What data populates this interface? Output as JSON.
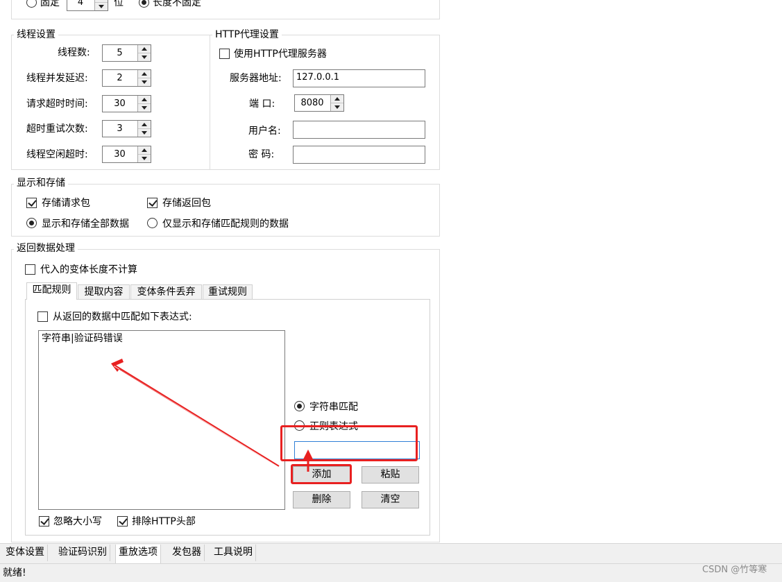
{
  "top_row": {
    "fixed_label": "固定",
    "digits_value": "4",
    "digits_unit": "位",
    "variable_label": "长度不固定"
  },
  "thread_settings": {
    "title": "线程设置",
    "fields": [
      {
        "label": "线程数:",
        "value": "5"
      },
      {
        "label": "线程并发延迟:",
        "value": "2"
      },
      {
        "label": "请求超时时间:",
        "value": "30"
      },
      {
        "label": "超时重试次数:",
        "value": "3"
      },
      {
        "label": "线程空闲超时:",
        "value": "30"
      }
    ]
  },
  "proxy_settings": {
    "title": "HTTP代理设置",
    "use_proxy_label": "使用HTTP代理服务器",
    "server_label": "服务器地址:",
    "server_value": "127.0.0.1",
    "port_label": "端  口:",
    "port_value": "8080",
    "username_label": "用户名:",
    "username_value": "",
    "password_label": "密  码:",
    "password_value": ""
  },
  "display_storage": {
    "title": "显示和存储",
    "save_request_label": "存储请求包",
    "save_response_label": "存储返回包",
    "show_all_label": "显示和存储全部数据",
    "show_matched_label": "仅显示和存储匹配规则的数据"
  },
  "response_processing": {
    "title": "返回数据处理",
    "no_length_label": "代入的变体长度不计算",
    "tabs": [
      "匹配规则",
      "提取内容",
      "变体条件丢弃",
      "重试规则"
    ],
    "match_expr_label": "从返回的数据中匹配如下表达式:",
    "rules_text": "字符串|验证码错误",
    "string_match_label": "字符串匹配",
    "regex_label": "正则表达式",
    "new_rule_value": "",
    "add_label": "添加",
    "paste_label": "粘贴",
    "delete_label": "删除",
    "clear_label": "清空",
    "ignore_case_label": "忽略大小写",
    "exclude_header_label": "排除HTTP头部"
  },
  "bottom_tabs": [
    "变体设置",
    "验证码识别",
    "重放选项",
    "发包器",
    "工具说明"
  ],
  "status": {
    "text": "就绪!",
    "watermark": "CSDN @竹等寒"
  },
  "colors": {
    "annotation_red": "#e82020",
    "input_focus_blue": "#2f7fd6"
  }
}
